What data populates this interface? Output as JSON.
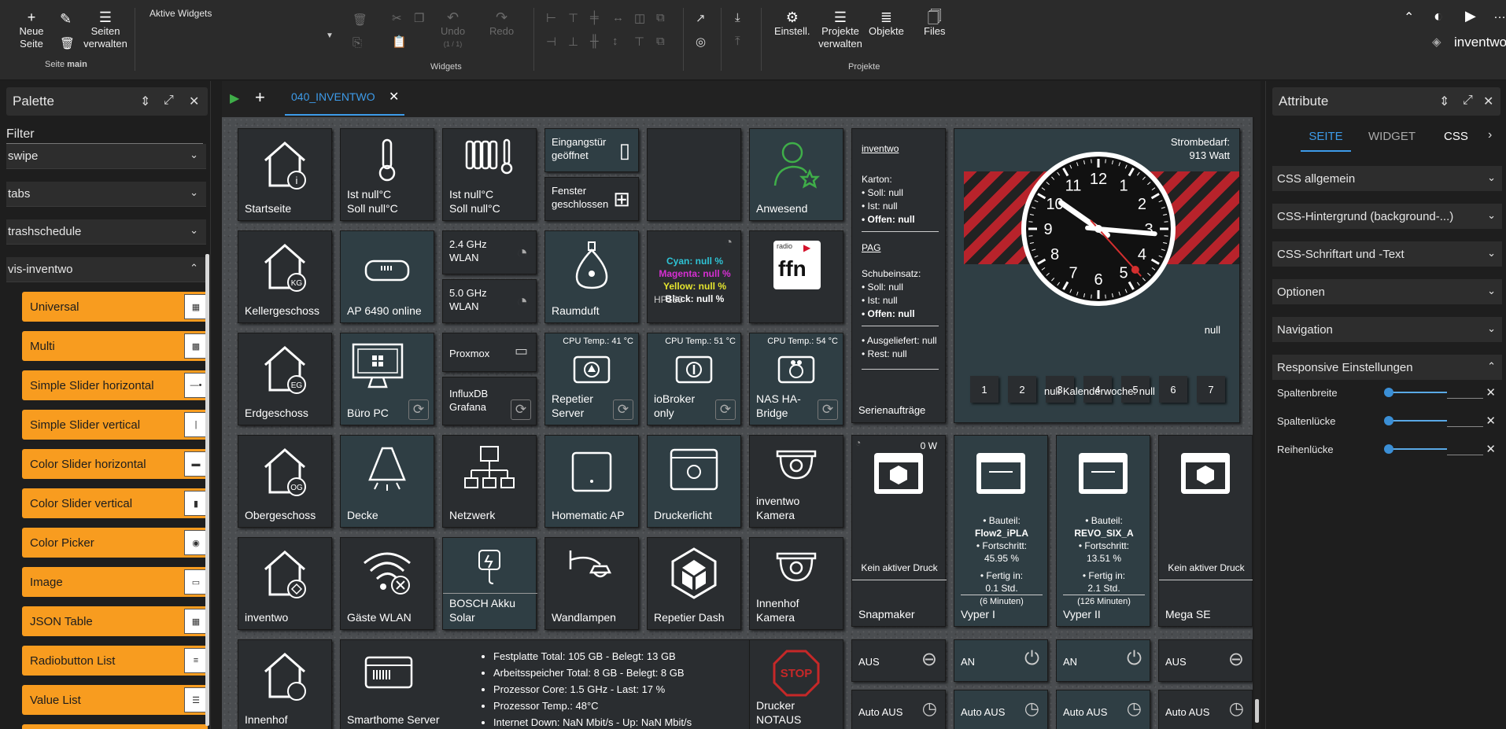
{
  "toolbar": {
    "new_page": "Neue Seite",
    "manage_pages": "Seiten verwalten",
    "page_label": "Seite",
    "page_name": "main",
    "active_widgets": "Aktive Widgets",
    "undo": "Undo",
    "undo_count": "(1 / 1)",
    "redo": "Redo",
    "widgets_group": "Widgets",
    "settings": "Einstell.",
    "manage_projects": "Projekte verwalten",
    "objects": "Objekte",
    "files": "Files",
    "projects_group": "Projekte",
    "project_name": "inventwo"
  },
  "palette": {
    "title": "Palette",
    "filter_label": "Filter",
    "groups": [
      "swipe",
      "tabs",
      "trashschedule",
      "vis-inventwo"
    ],
    "items": [
      {
        "label": "Universal",
        "thumb": "▦"
      },
      {
        "label": "Multi",
        "thumb": "▩"
      },
      {
        "label": "Simple Slider horizontal",
        "thumb": "—•"
      },
      {
        "label": "Simple Slider vertical",
        "thumb": "|"
      },
      {
        "label": "Color Slider horizontal",
        "thumb": "▬"
      },
      {
        "label": "Color Slider vertical",
        "thumb": "▮"
      },
      {
        "label": "Color Picker",
        "thumb": "◉"
      },
      {
        "label": "Image",
        "thumb": "▭"
      },
      {
        "label": "JSON Table",
        "thumb": "▦"
      },
      {
        "label": "Radiobutton List",
        "thumb": "≡"
      },
      {
        "label": "Value List",
        "thumb": "☰"
      }
    ]
  },
  "tabs": {
    "active": "040_INVENTWO"
  },
  "tiles": {
    "startseite": "Startseite",
    "ist1": "Ist null°C",
    "soll1": "Soll null°C",
    "ist2": "Ist null°C",
    "soll2": "Soll null°C",
    "eingangstuer": "Eingangstür geöffnet",
    "fenster": "Fenster geschlossen",
    "anwesend": "Anwesend",
    "kellergeschoss": "Kellergeschoss",
    "ap6490": "AP 6490 online",
    "wlan24": "2.4 GHz WLAN",
    "wlan50": "5.0 GHz WLAN",
    "raumduft": "Raumduft",
    "printer_cyan": "Cyan: null %",
    "printer_magenta": "Magenta: null %",
    "printer_yellow": "Yellow: null %",
    "printer_black": "Black: null %",
    "printer_name": "HP150",
    "erdgeschoss": "Erdgeschoss",
    "buero_pc": "Büro PC",
    "proxmox": "Proxmox",
    "influx": "InfluxDB Grafana",
    "cpu1": "CPU Temp.: 41 °C",
    "repetier_server": "Repetier Server",
    "cpu2": "CPU Temp.: 51 °C",
    "iobroker": "ioBroker only",
    "cpu3": "CPU Temp.: 54 °C",
    "nas": "NAS HA-Bridge",
    "obergeschoss": "Obergeschoss",
    "decke": "Decke",
    "netzwerk": "Netzwerk",
    "homematic": "Homematic AP",
    "druckerlicht": "Druckerlicht",
    "inventwo_kamera": "inventwo Kamera",
    "inventwo": "inventwo",
    "gaeste_wlan": "Gäste WLAN",
    "bosch": "BOSCH Akku Solar",
    "wandlampen": "Wandlampen",
    "repetier_dash": "Repetier Dash",
    "innenhof_kamera": "Innenhof Kamera",
    "innenhof": "Innenhof",
    "smarthome_server": "Smarthome Server",
    "drucker_notaus": "Drucker NOTAUS"
  },
  "info_panel": {
    "title": "inventwo",
    "karton": "Karton:",
    "soll": "• Soll: null",
    "ist": "• Ist: null",
    "offen": "• Offen: null",
    "pag": "PAG",
    "schubeinsatz": "Schubeinsatz:",
    "soll2": "• Soll: null",
    "ist2": "• Ist: null",
    "offen2": "• Offen: null",
    "ausgeliefert": "• Ausgeliefert: null",
    "rest": "• Rest: null",
    "serien": "Serienaufträge"
  },
  "clock_panel": {
    "strombedarf": "Strombedarf:",
    "watt": "913 Watt",
    "null_val": "null",
    "kw_text": "null Kalenderwoche: null",
    "days": [
      "1",
      "2",
      "3",
      "4",
      "5",
      "6",
      "7"
    ],
    "numbers": [
      "12",
      "1",
      "2",
      "3",
      "4",
      "5",
      "6",
      "7",
      "8",
      "9",
      "10",
      "11"
    ]
  },
  "printers": {
    "snapmaker_power": "0 W",
    "snapmaker_status": "Kein aktiver Druck",
    "snapmaker": "Snapmaker",
    "vyper1_part_label": "• Bauteil:",
    "vyper1_part": "Flow2_iPLA",
    "vyper1_prog_label": "• Fortschritt:",
    "vyper1_prog": "45.95 %",
    "vyper1_done_label": "• Fertig in:",
    "vyper1_done": "0.1 Std.",
    "vyper1_min": "(6 Minuten)",
    "vyper1": "Vyper I",
    "vyper2_part_label": "• Bauteil:",
    "vyper2_part": "REVO_SIX_A",
    "vyper2_prog_label": "• Fortschritt:",
    "vyper2_prog": "13.51 %",
    "vyper2_done_label": "• Fertig in:",
    "vyper2_done": "2.1 Std.",
    "vyper2_min": "(126 Minuten)",
    "vyper2": "Vyper II",
    "mega_status": "Kein aktiver Druck",
    "mega": "Mega SE"
  },
  "server_stats": [
    "Festplatte Total: 105 GB - Belegt: 13 GB",
    "Arbeitsspeicher Total: 8 GB - Belegt: 8 GB",
    "Prozessor Core: 1.5 GHz - Last: 17 %",
    "Prozessor Temp.: 48°C",
    "Internet Down: NaN Mbit/s - Up: NaN Mbit/s"
  ],
  "switches": {
    "s1": "AUS",
    "s2": "AN",
    "s3": "AN",
    "s4": "AUS",
    "a1": "Auto AUS",
    "a2": "Auto AUS",
    "a3": "Auto AUS",
    "a4": "Auto AUS"
  },
  "attributes": {
    "title": "Attribute",
    "tab_seite": "SEITE",
    "tab_widget": "WIDGET",
    "tab_css": "CSS",
    "sections": [
      "CSS allgemein",
      "CSS-Hintergrund (background-...)",
      "CSS-Schriftart und -Text",
      "Optionen",
      "Navigation",
      "Responsive Einstellungen"
    ],
    "sliders": [
      "Spaltenbreite",
      "Spaltenlücke",
      "Reihenlücke"
    ]
  },
  "colors": {
    "accent": "#f89c1f",
    "tab_blue": "#3d9be9",
    "tile_dark": "#2a2d30",
    "tile_teal": "#2f3e44"
  }
}
